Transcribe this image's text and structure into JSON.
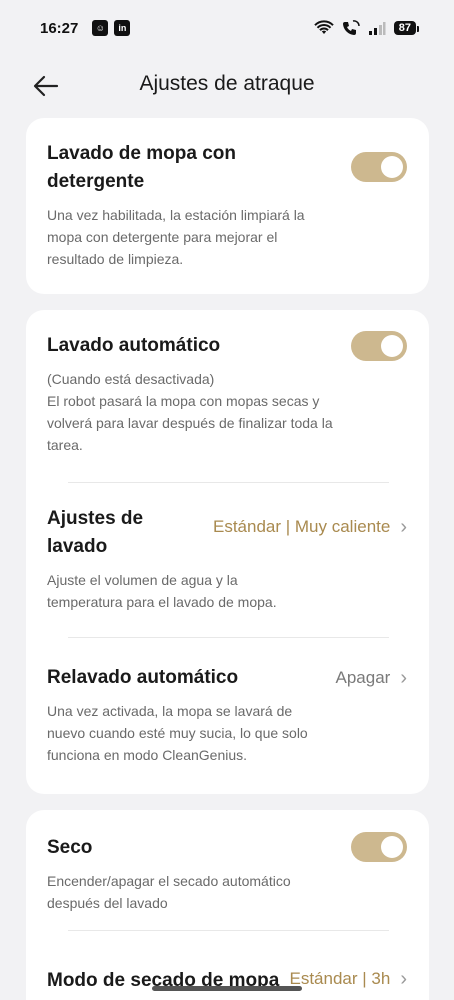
{
  "status_bar": {
    "time": "16:27",
    "battery": "87",
    "app_icon_1": "smiley-app-icon",
    "app_icon_2": "linkedin-icon"
  },
  "header": {
    "title": "Ajustes de atraque",
    "back_icon": "arrow-left-icon"
  },
  "cards": {
    "detergent": {
      "title": "Lavado de mopa con detergente",
      "desc": "Una vez habilitada, la estación limpiará la mopa con detergente para mejorar el resultado de limpieza.",
      "enabled": true
    },
    "auto_wash": {
      "title": "Lavado automático",
      "desc_line1": "(Cuando está desactivada)",
      "desc_line2": "El robot pasará la mopa con mopas secas y volverá para lavar después de finalizar toda la tarea.",
      "enabled": true
    },
    "wash_settings": {
      "title": "Ajustes de lavado",
      "value": "Estándar | Muy caliente",
      "desc": "Ajuste el volumen de agua y la temperatura para el lavado de mopa."
    },
    "auto_rewash": {
      "title": "Relavado automático",
      "value": "Apagar",
      "desc": "Una vez activada, la mopa se lavará de nuevo cuando esté muy sucia, lo que solo funciona en modo CleanGenius."
    },
    "dry": {
      "title": "Seco",
      "desc": "Encender/apagar el secado automático después del lavado",
      "enabled": true
    },
    "dry_mode": {
      "title": "Modo de secado de mopa",
      "value": "Estándar | 3h"
    }
  },
  "colors": {
    "accent": "#cdb88f",
    "accent_text": "#a98a4f",
    "background": "#f2f2f4",
    "card": "#ffffff"
  }
}
